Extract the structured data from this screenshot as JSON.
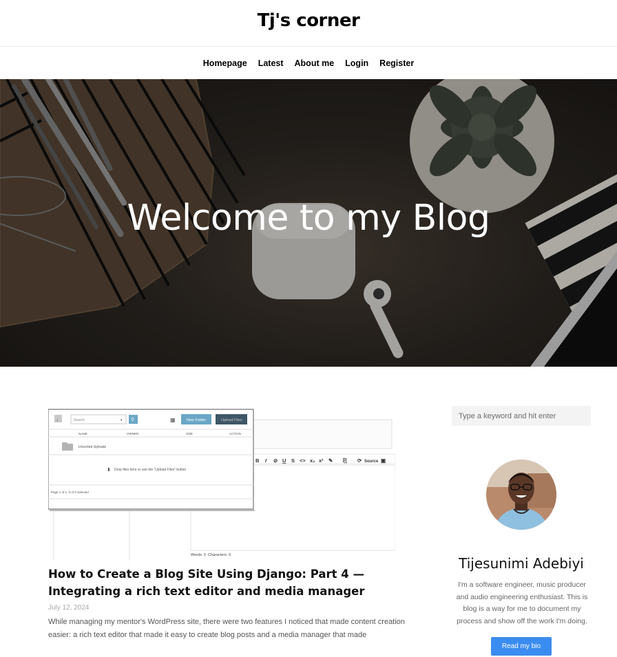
{
  "site": {
    "title": "Tj's corner"
  },
  "nav": {
    "items": [
      "Homepage",
      "Latest",
      "About me",
      "Login",
      "Register"
    ]
  },
  "hero": {
    "title": "Welcome to my Blog"
  },
  "post": {
    "title": "How to Create a Blog Site Using Django: Part 4 — Integrating a rich text editor and media manager",
    "date": "July 12, 2024",
    "excerpt": "While managing my mentor's WordPress site, there were two features I noticed that made content creation easier: a rich text editor that made it easy to create blog posts and a media manager that made",
    "thumbnail": {
      "search_placeholder": "Search",
      "new_folder": "New Folder",
      "upload_files": "Upload Files",
      "columns": [
        "NAME",
        "OWNER",
        "SIZE",
        "ACTION"
      ],
      "folder": "Unsorted Uploads",
      "drop_hint": "Drop files here or use the \"Upload Files\" button",
      "page_info": "Page 1 of 1, 0 of 0 selected",
      "source_label": "Source",
      "word_count": "Words: 0",
      "char_count": "Characters: 0"
    }
  },
  "sidebar": {
    "search_placeholder": "Type a keyword and hit enter",
    "author_name": "Tijesunimi Adebiyi",
    "author_bio": "I'm a software engineer, music producer and audio engineering enthusiast. This is blog is a way for me to document my process and show off the work I'm doing.",
    "bio_button": "Read my bio"
  },
  "colors": {
    "accent": "#3b8cf0",
    "new_folder_btn": "#6aa7c6",
    "upload_btn": "#3f5766"
  }
}
